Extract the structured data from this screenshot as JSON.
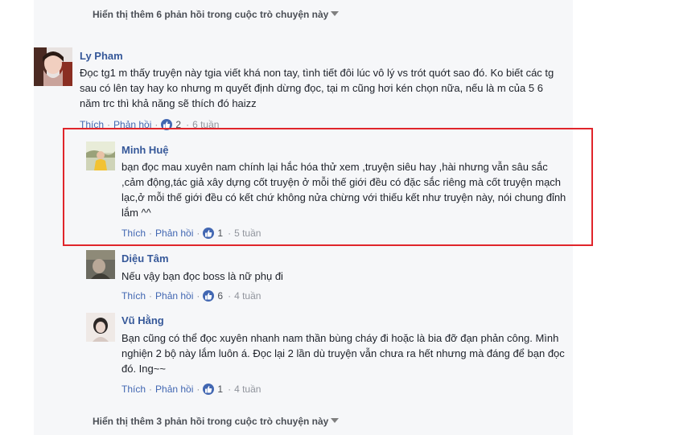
{
  "more_replies_top": {
    "label": "Hiển thị thêm 6 phản hồi trong cuộc trò chuyện này"
  },
  "more_replies_bottom": {
    "label": "Hiển thị thêm 3 phản hồi trong cuộc trò chuyện này"
  },
  "comments": [
    {
      "author": "Ly Pham",
      "text": "Đọc tg1 m thấy truyện này tgia viết khá non tay, tình tiết đôi lúc vô lý vs trót quớt sao đó. Ko biết các tg sau có lên tay hay ko nhưng m quyết định dừng đọc, tại m cũng hơi kén chọn nữa, nếu là m của 5 6 năm trc thì khả năng sẽ thích đó haizz",
      "like_label": "Thích",
      "reply_label": "Phản hồi",
      "reactions": "2",
      "time": "6 tuần"
    },
    {
      "author": "Minh Huệ",
      "text": "bạn đọc mau xuyên nam chính lại hắc hóa thử xem ,truyện siêu hay ,hài nhưng vẫn sâu sắc ,cảm động,tác giả xây dựng cốt truyện ở mỗi thế giới đều có đặc sắc riêng mà cốt truyện mạch lạc,ở mỗi thế giới đều có kết chứ không nửa chừng với thiếu kết như truyện này, nói chung đỉnh lắm ^^",
      "like_label": "Thích",
      "reply_label": "Phản hồi",
      "reactions": "1",
      "time": "5 tuần"
    },
    {
      "author": "Diệu Tâm",
      "text": "Nếu vậy bạn đọc boss là nữ phụ đi",
      "like_label": "Thích",
      "reply_label": "Phản hồi",
      "reactions": "6",
      "time": "4 tuần"
    },
    {
      "author": "Vũ Hằng",
      "text": "Bạn cũng có thể đọc xuyên nhanh nam thần bùng cháy đi hoặc là bia đỡ đạn phản công. Mình nghiện 2 bộ này lắm luôn á. Đọc lại 2 lần dù truyện vẫn chưa ra hết nhưng mà đáng để bạn đọc đó. Ing~~",
      "like_label": "Thích",
      "reply_label": "Phản hồi",
      "reactions": "1",
      "time": "4 tuần"
    }
  ],
  "colors": {
    "link": "#4267b2",
    "name": "#365899",
    "meta": "#90949c",
    "highlight": "#e0252b",
    "panel": "#f6f7f9"
  }
}
